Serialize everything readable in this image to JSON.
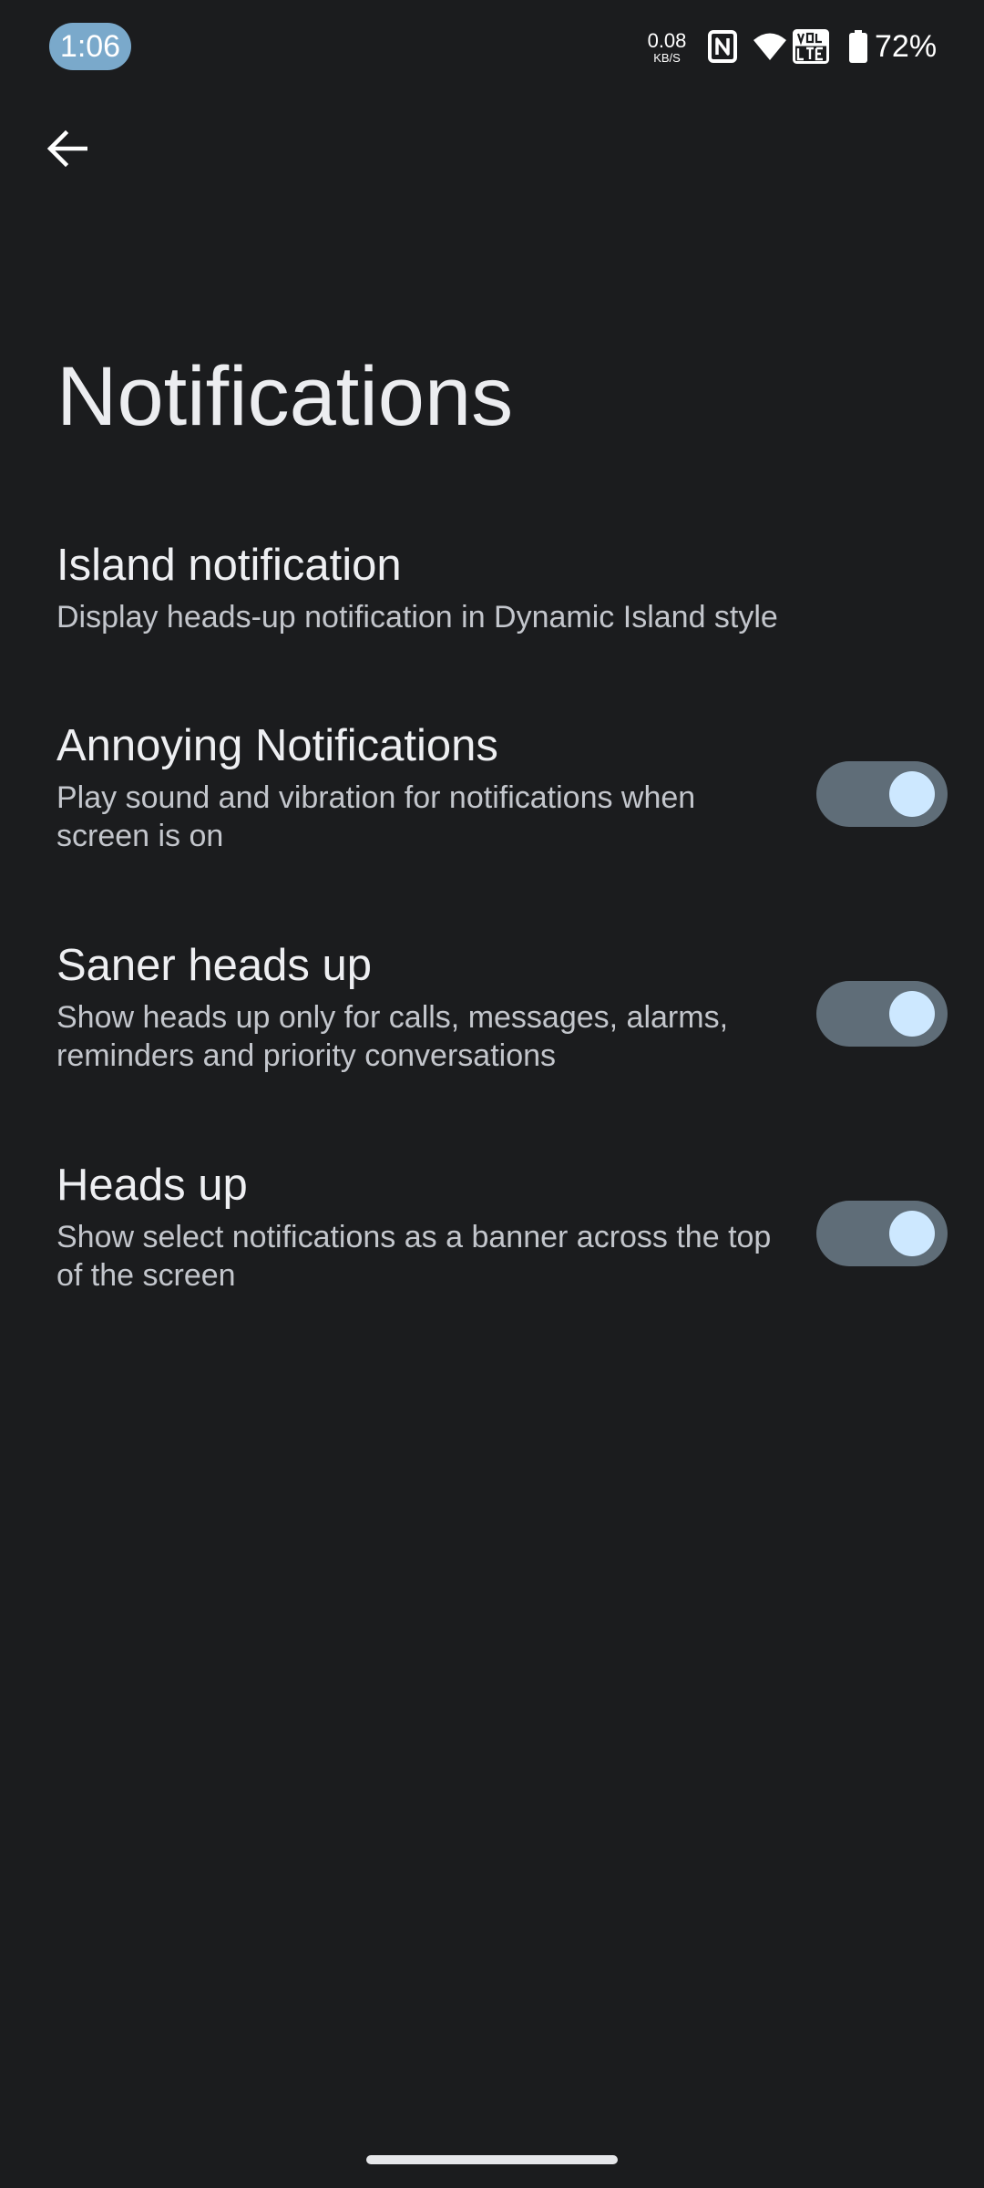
{
  "status_bar": {
    "time": "1:06",
    "net_speed_value": "0.08",
    "net_speed_unit": "KB/S",
    "battery_percent": "72%",
    "icons": [
      "nfc-icon",
      "wifi-icon",
      "volte-icon",
      "battery-icon"
    ],
    "clock_pill_color": "#7aa9cb"
  },
  "header": {
    "back_icon": "arrow-left-icon",
    "title": "Notifications"
  },
  "settings": [
    {
      "title": "Island notification",
      "summary": "Display heads-up notification in Dynamic Island style",
      "has_toggle": false
    },
    {
      "title": "Annoying Notifications",
      "summary": "Play sound and vibration for notifications when screen is on",
      "has_toggle": true,
      "toggle_on": true
    },
    {
      "title": "Saner heads up",
      "summary": "Show heads up only for calls, messages, alarms, reminders and priority conversations",
      "has_toggle": true,
      "toggle_on": true
    },
    {
      "title": "Heads up",
      "summary": "Show select notifications as a banner across the top of the screen",
      "has_toggle": true,
      "toggle_on": true
    }
  ],
  "colors": {
    "background": "#1b1c1e",
    "toggle_track": "#5f6d78",
    "toggle_thumb": "#cde8ff"
  }
}
